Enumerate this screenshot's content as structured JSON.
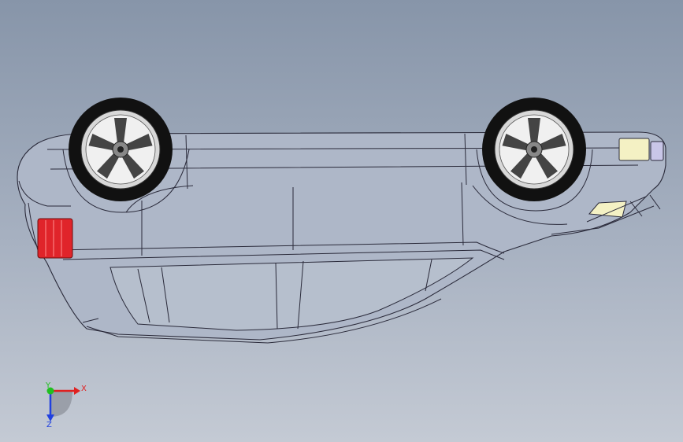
{
  "viewport": {
    "background_top": "#8795a9",
    "background_bottom": "#c4cad4",
    "edge_color": "#2a2a3a",
    "body_fill": "#aeb7c8"
  },
  "car_model": {
    "wheels": [
      "front-wheel",
      "rear-wheel"
    ],
    "tail_light_color": "#e0242a",
    "headlight_color": "#f4f1c4",
    "tire_color": "#111111",
    "rim_color": "#d8d8d8"
  },
  "triad": {
    "x_label": "X",
    "y_label": "Y",
    "z_label": "Z",
    "x_color": "#e02020",
    "y_color": "#20c020",
    "z_color": "#2040e0"
  }
}
